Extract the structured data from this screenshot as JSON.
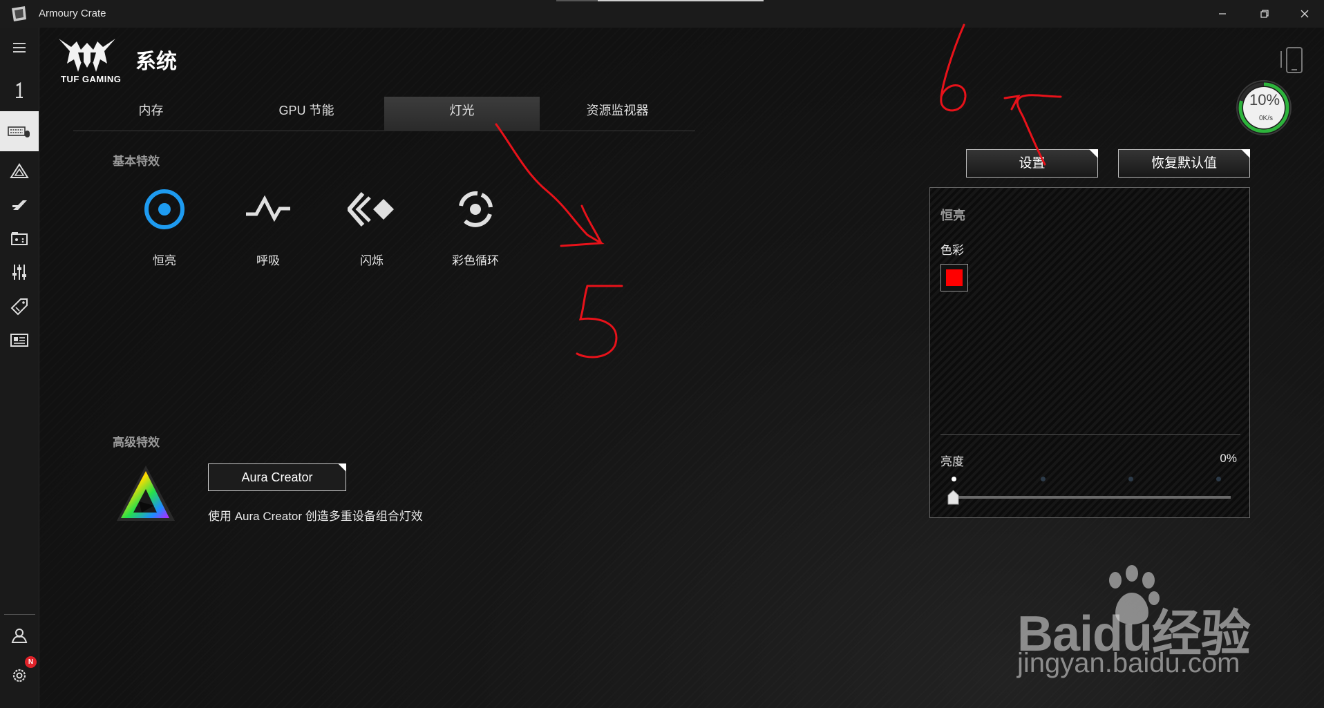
{
  "window": {
    "title": "Armoury Crate"
  },
  "header": {
    "logo_text": "TUF GAMING",
    "page_title": "系统"
  },
  "tabs": [
    {
      "label": "内存",
      "active": false
    },
    {
      "label": "GPU 节能",
      "active": false
    },
    {
      "label": "灯光",
      "active": true
    },
    {
      "label": "资源监视器",
      "active": false
    }
  ],
  "basic": {
    "label": "基本特效",
    "effects": [
      {
        "label": "恒亮",
        "icon": "static-icon",
        "selected": true
      },
      {
        "label": "呼吸",
        "icon": "breathing-icon",
        "selected": false
      },
      {
        "label": "闪烁",
        "icon": "strobing-icon",
        "selected": false
      },
      {
        "label": "彩色循环",
        "icon": "color-cycle-icon",
        "selected": false
      }
    ]
  },
  "advanced": {
    "label": "高级特效",
    "button_label": "Aura Creator",
    "description": "使用 Aura Creator 创造多重设备组合灯效"
  },
  "panel": {
    "settings_label": "设置",
    "reset_label": "恢复默认值",
    "effect_title": "恒亮",
    "color_label": "色彩",
    "color_value": "#ff0000",
    "brightness_label": "亮度",
    "brightness_value": "0%",
    "brightness_level": 0
  },
  "cpu_gauge": {
    "percent": "10%",
    "rate": "0K/s"
  },
  "annotations": [
    "5",
    "6"
  ],
  "watermark": {
    "main": "Baidu经验",
    "sub": "jingyan.baidu.com"
  },
  "notification_badge": "N",
  "colors": {
    "accent": "#1e9bf0",
    "selected_color": "#ff0000",
    "gauge_green": "#2ecc40",
    "annotation_red": "#e8121a"
  }
}
